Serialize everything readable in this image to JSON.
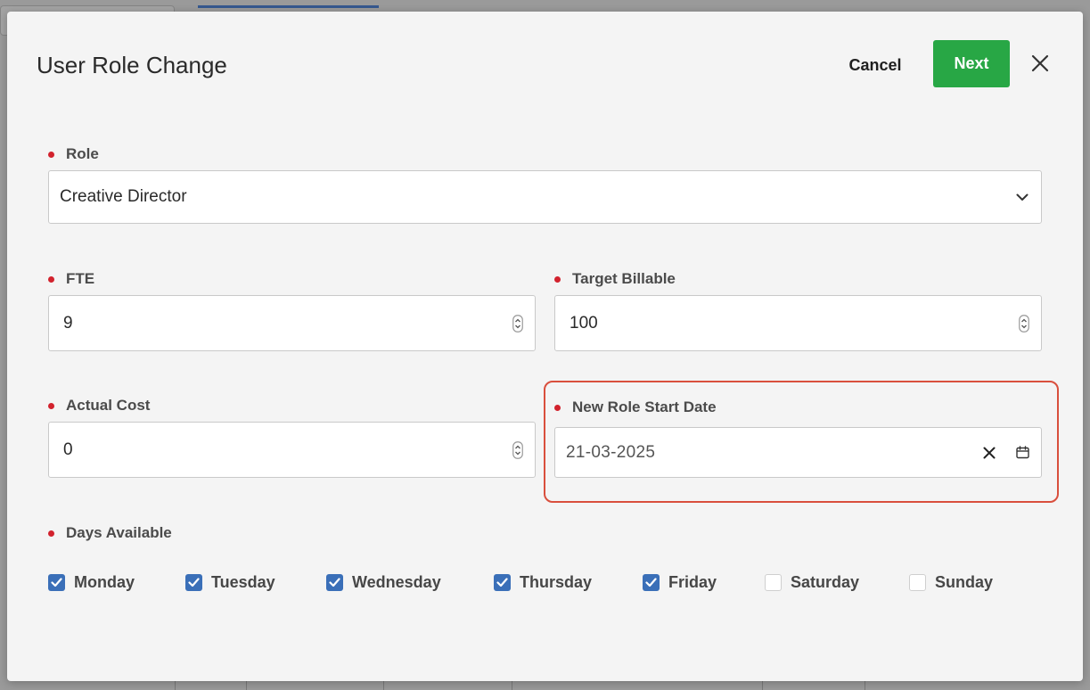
{
  "modal": {
    "title": "User Role Change",
    "cancel_label": "Cancel",
    "next_label": "Next"
  },
  "fields": {
    "role": {
      "label": "Role",
      "value": "Creative Director"
    },
    "fte": {
      "label": "FTE",
      "value": "9"
    },
    "target_billable": {
      "label": "Target Billable",
      "value": "100"
    },
    "actual_cost": {
      "label": "Actual Cost",
      "value": "0"
    },
    "new_role_start_date": {
      "label": "New Role Start Date",
      "value": "21-03-2025"
    }
  },
  "days_available": {
    "label": "Days Available",
    "days": [
      {
        "label": "Monday",
        "checked": true
      },
      {
        "label": "Tuesday",
        "checked": true
      },
      {
        "label": "Wednesday",
        "checked": true
      },
      {
        "label": "Thursday",
        "checked": true
      },
      {
        "label": "Friday",
        "checked": true
      },
      {
        "label": "Saturday",
        "checked": false
      },
      {
        "label": "Sunday",
        "checked": false
      }
    ]
  },
  "colors": {
    "primary_green": "#28a745",
    "required_dot": "#d2222d",
    "checkbox_checked": "#3a6fb8",
    "highlight_border": "#d94f3d"
  },
  "icons": [
    "close-icon",
    "chevron-down-icon",
    "spinner-icon",
    "clear-icon",
    "calendar-icon",
    "check-icon"
  ]
}
